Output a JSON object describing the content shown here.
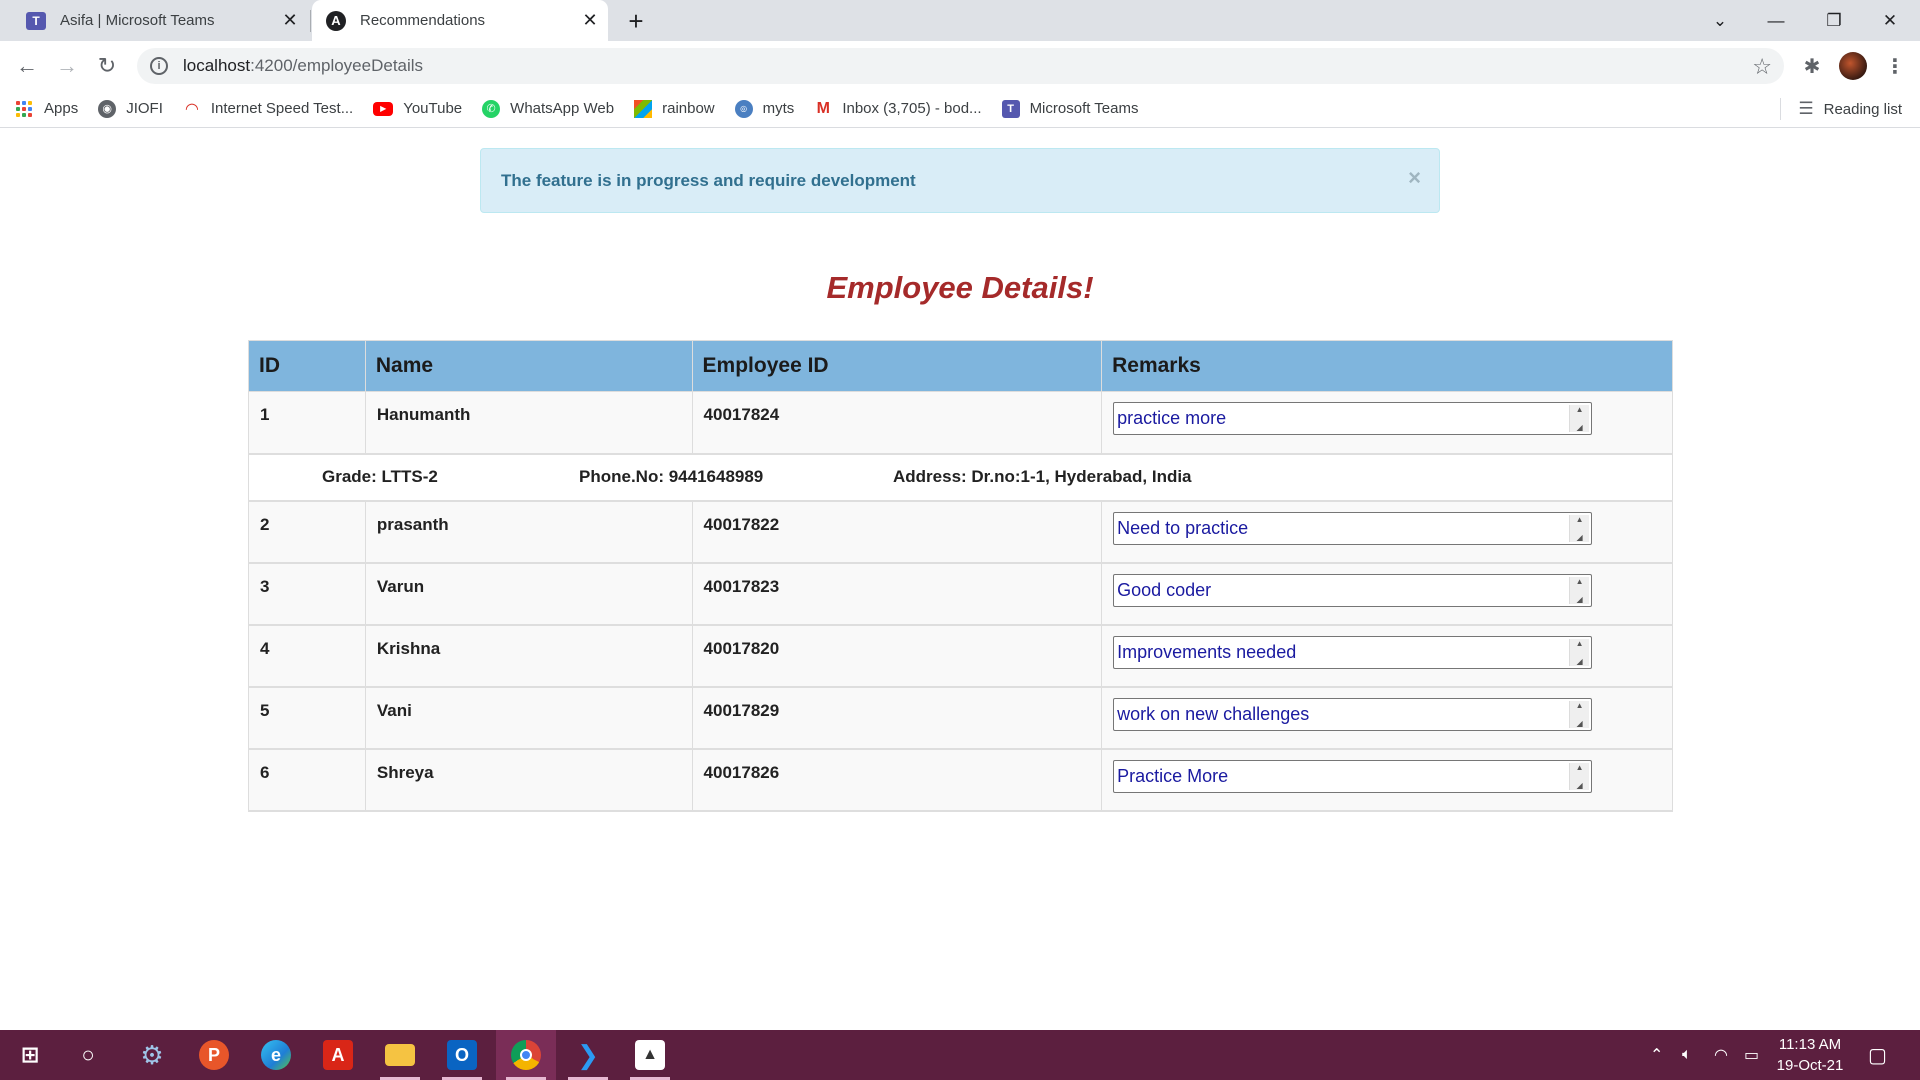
{
  "browser": {
    "tabs": [
      {
        "title": "Asifa | Microsoft Teams",
        "icon": "teams-icon"
      },
      {
        "title": "Recommendations",
        "icon": "angular-icon"
      }
    ],
    "url_host": "localhost",
    "url_path": ":4200/employeeDetails",
    "bookmarks": [
      {
        "label": "Apps",
        "icon": "apps-grid-icon"
      },
      {
        "label": "JIOFI",
        "icon": "globe-icon"
      },
      {
        "label": "Internet Speed Test...",
        "icon": "speedometer-icon"
      },
      {
        "label": "YouTube",
        "icon": "youtube-icon"
      },
      {
        "label": "WhatsApp Web",
        "icon": "whatsapp-icon"
      },
      {
        "label": "rainbow",
        "icon": "rainbow-icon"
      },
      {
        "label": "myts",
        "icon": "myts-icon"
      },
      {
        "label": "Inbox (3,705) - bod...",
        "icon": "gmail-icon"
      },
      {
        "label": "Microsoft Teams",
        "icon": "teams-icon"
      }
    ],
    "reading_list": "Reading list"
  },
  "alert": {
    "message": "The feature is in progress and require development",
    "close": "×"
  },
  "page": {
    "title": "Employee Details!"
  },
  "table": {
    "headers": [
      "ID",
      "Name",
      "Employee ID",
      "Remarks"
    ],
    "rows": [
      {
        "id": "1",
        "name": "Hanumanth",
        "employee_id": "40017824",
        "remarks": "practice more"
      },
      {
        "id": "2",
        "name": "prasanth",
        "employee_id": "40017822",
        "remarks": "Need to practice"
      },
      {
        "id": "3",
        "name": "Varun",
        "employee_id": "40017823",
        "remarks": "Good coder"
      },
      {
        "id": "4",
        "name": "Krishna",
        "employee_id": "40017820",
        "remarks": "Improvements needed"
      },
      {
        "id": "5",
        "name": "Vani",
        "employee_id": "40017829",
        "remarks": "work on new challenges"
      },
      {
        "id": "6",
        "name": "Shreya",
        "employee_id": "40017826",
        "remarks": "Practice More"
      }
    ],
    "detail": {
      "grade": "Grade: LTTS-2",
      "phone": "Phone.No: 9441648989",
      "address": "Address: Dr.no:1-1, Hyderabad, India"
    }
  },
  "taskbar": {
    "time": "11:13 AM",
    "date": "19-Oct-21"
  },
  "colors": {
    "header_bg": "#7fb5dd",
    "title_color": "#a52a2a",
    "alert_bg": "#d9edf7",
    "alert_text": "#31708f",
    "taskbar_bg": "#5c1f3f"
  }
}
